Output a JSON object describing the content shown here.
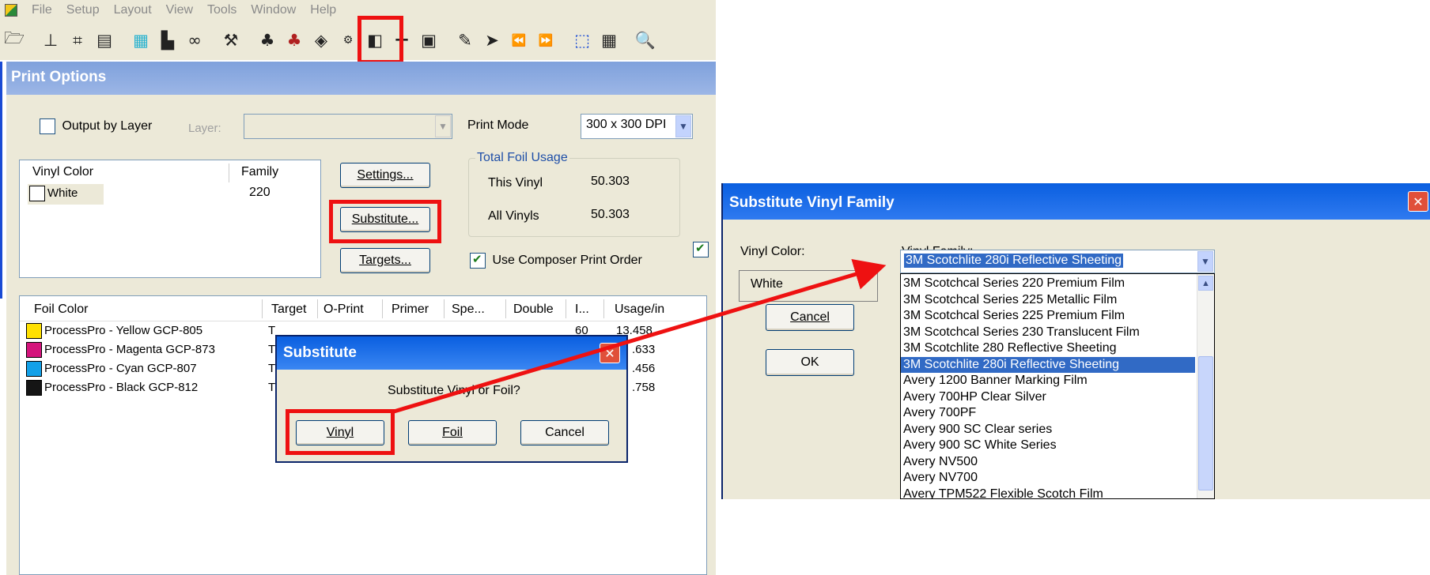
{
  "menubar": [
    "File",
    "Setup",
    "Layout",
    "View",
    "Tools",
    "Window",
    "Help"
  ],
  "toolbar_icons": [
    "open-icon",
    "align-icon",
    "distribute-icon",
    "page-icon",
    "grid-icon",
    "fill-icon",
    "glasses-icon",
    "tool-icon",
    "layers-icon",
    "layers2-icon",
    "palette-icon",
    "print-options-icon",
    "frame-icon",
    "move-icon",
    "panel-icon",
    "pen-icon",
    "cursor-icon",
    "rewind-icon",
    "forward-icon",
    "select-icon",
    "table-icon",
    "zoom-icon"
  ],
  "print_options": {
    "title": "Print Options",
    "output_by_layer": "Output by Layer",
    "layer_label": "Layer:",
    "print_mode_label": "Print Mode",
    "print_mode_value": "300 x 300 DPI",
    "vinyl_table": {
      "col1": "Vinyl Color",
      "col2": "Family",
      "row_color": "White",
      "row_family": "220"
    },
    "buttons": {
      "settings": "Settings...",
      "substitute": "Substitute...",
      "targets": "Targets..."
    },
    "foil_usage": {
      "title": "Total Foil Usage",
      "this_vinyl": "This Vinyl",
      "this_vinyl_value": "50.303",
      "all_vinyls": "All Vinyls",
      "all_vinyls_value": "50.303"
    },
    "use_composer": "Use Composer Print Order",
    "foil_headers": [
      "Foil Color",
      "Target",
      "O-Print",
      "Primer",
      "Spe...",
      "Double",
      "I...",
      "Usage/in"
    ],
    "foils": [
      {
        "name": "ProcessPro - Yellow GCP-805",
        "color": "#ffe000",
        "t": "T",
        "i": "60",
        "usage": "13.458"
      },
      {
        "name": "ProcessPro - Magenta GCP-873",
        "color": "#d4147c",
        "t": "T",
        "i": "",
        "usage": ".633"
      },
      {
        "name": "ProcessPro - Cyan GCP-807",
        "color": "#12a0e8",
        "t": "T",
        "i": "",
        "usage": ".456"
      },
      {
        "name": "ProcessPro - Black GCP-812",
        "color": "#151515",
        "t": "T",
        "i": "",
        "usage": ".758"
      }
    ]
  },
  "substitute": {
    "title": "Substitute",
    "question": "Substitute Vinyl or Foil?",
    "vinyl": "Vinyl",
    "foil": "Foil",
    "cancel": "Cancel"
  },
  "svf": {
    "title": "Substitute Vinyl Family",
    "vinyl_color_label": "Vinyl Color:",
    "vinyl_color_value": "White",
    "vinyl_family_label": "Vinyl Family:",
    "selected": "3M Scotchlite 280i Reflective Sheeting",
    "cancel": "Cancel",
    "ok": "OK",
    "items": [
      "3M Scotchcal Series 220 Premium Film",
      "3M Scotchcal Series 225 Metallic Film",
      "3M Scotchcal Series 225 Premium Film",
      "3M Scotchcal Series 230 Translucent Film",
      "3M Scotchlite 280 Reflective Sheeting",
      "3M Scotchlite 280i Reflective Sheeting",
      "Avery 1200 Banner Marking Film",
      "Avery 700HP Clear Silver",
      "Avery 700PF",
      "Avery 900 SC Clear series",
      "Avery 900 SC White Series",
      "Avery NV500",
      "Avery NV700",
      "Avery TPM522 Flexible Scotch Film"
    ],
    "selected_index": 5
  }
}
